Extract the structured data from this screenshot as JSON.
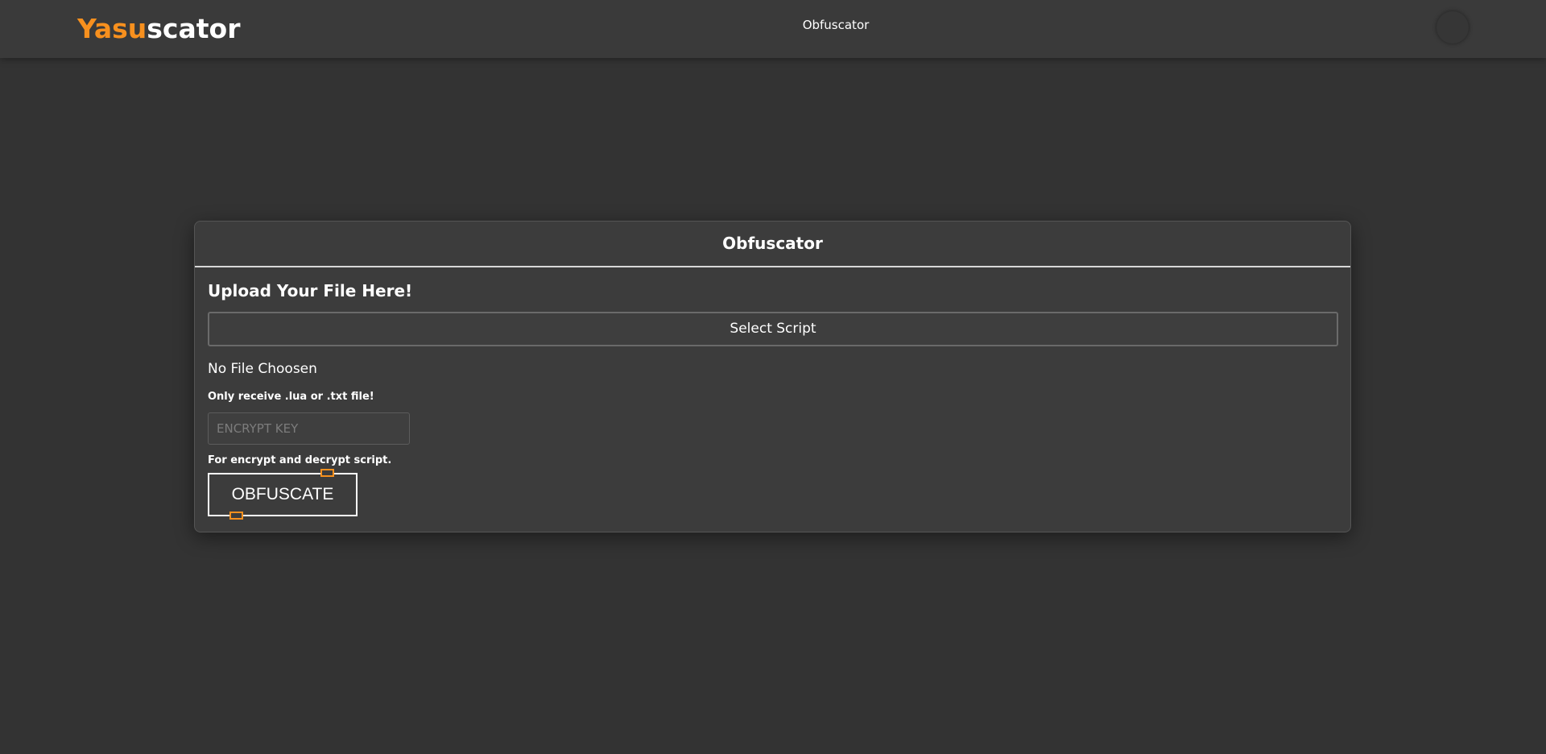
{
  "header": {
    "logo_part1": "Yasu",
    "logo_part2": "scator",
    "nav_link": "Obfuscator"
  },
  "card": {
    "title": "Obfuscator",
    "upload_title": "Upload Your File Here!",
    "select_button": "Select Script",
    "file_status": "No File Choosen",
    "file_hint": "Only receive .lua or .txt file!",
    "key_placeholder": "ENCRYPT KEY",
    "key_hint": "For encrypt and decrypt script.",
    "submit_button": "OBFUSCATE"
  },
  "colors": {
    "background": "#333333",
    "topbar": "#3a3a3a",
    "card": "#3c3c3c",
    "accent": "#f7901e",
    "text": "#ffffff"
  }
}
